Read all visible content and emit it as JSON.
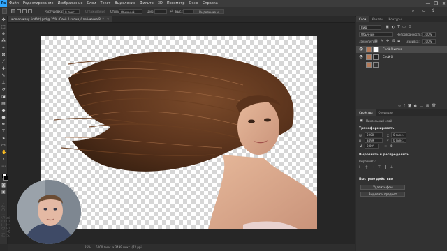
{
  "app": {
    "logo": "Ps"
  },
  "menu": [
    "Файл",
    "Редактирование",
    "Изображение",
    "Слои",
    "Текст",
    "Выделение",
    "Фильтр",
    "3D",
    "Просмотр",
    "Окно",
    "Справка"
  ],
  "window_controls": [
    "—",
    "❐",
    "✕"
  ],
  "options": {
    "feather_label": "Растушевка:",
    "feather_value": "0 пикс.",
    "antialias": "Сглаживание",
    "style_label": "Стиль:",
    "style_value": "Обычный",
    "width_label": "Шир.:",
    "height_label": "Выс.:",
    "select_mask_button": "Выделение и маска..."
  },
  "document": {
    "tab_title": "woman wavy (indfot).psd @ 25% (Слой 0 копия, Слой-маска/8) *",
    "zoom": "25%",
    "status": "5000 пикс. x 3499 пикс. (72 ppi)"
  },
  "tools": [
    "move",
    "marquee",
    "lasso",
    "magic-wand",
    "crop",
    "frame",
    "eyedropper",
    "healing",
    "brush",
    "stamp",
    "history-brush",
    "eraser",
    "gradient",
    "blur",
    "dodge",
    "pen",
    "type",
    "path-select",
    "rectangle",
    "hand",
    "zoom",
    "more"
  ],
  "panels": {
    "layers": {
      "tabs": [
        "Слои",
        "Каналы",
        "Контуры"
      ],
      "search": "Вид",
      "blend_mode": "Обычные",
      "opacity_label": "Непрозрачность:",
      "opacity_value": "100%",
      "lock_label": "Закрепить:",
      "fill_label": "Заливка:",
      "fill_value": "100%",
      "items": [
        {
          "name": "Слой 0 копия",
          "visible": true,
          "selected": true
        },
        {
          "name": "Слой 0",
          "visible": true,
          "selected": false
        },
        {
          "name": "",
          "visible": false,
          "selected": false
        }
      ]
    },
    "properties": {
      "tabs": [
        "Свойства",
        "Операции"
      ],
      "kind": "Пиксельный слой",
      "transform_title": "Трансформировать",
      "w_value": "5000 пикс.",
      "h_value": "3499 пикс.",
      "x_value": "0 пикс.",
      "y_value": "0 пикс.",
      "angle_value": "0,00°",
      "align_title": "Выровнять и распределить",
      "align_sub": "Выровнять:",
      "quick_title": "Быстрые действия",
      "remove_bg_button": "Удалить фон",
      "select_subject_button": "Выделить предмет"
    }
  },
  "watermark": "PHOTOSHOP-MASTER"
}
